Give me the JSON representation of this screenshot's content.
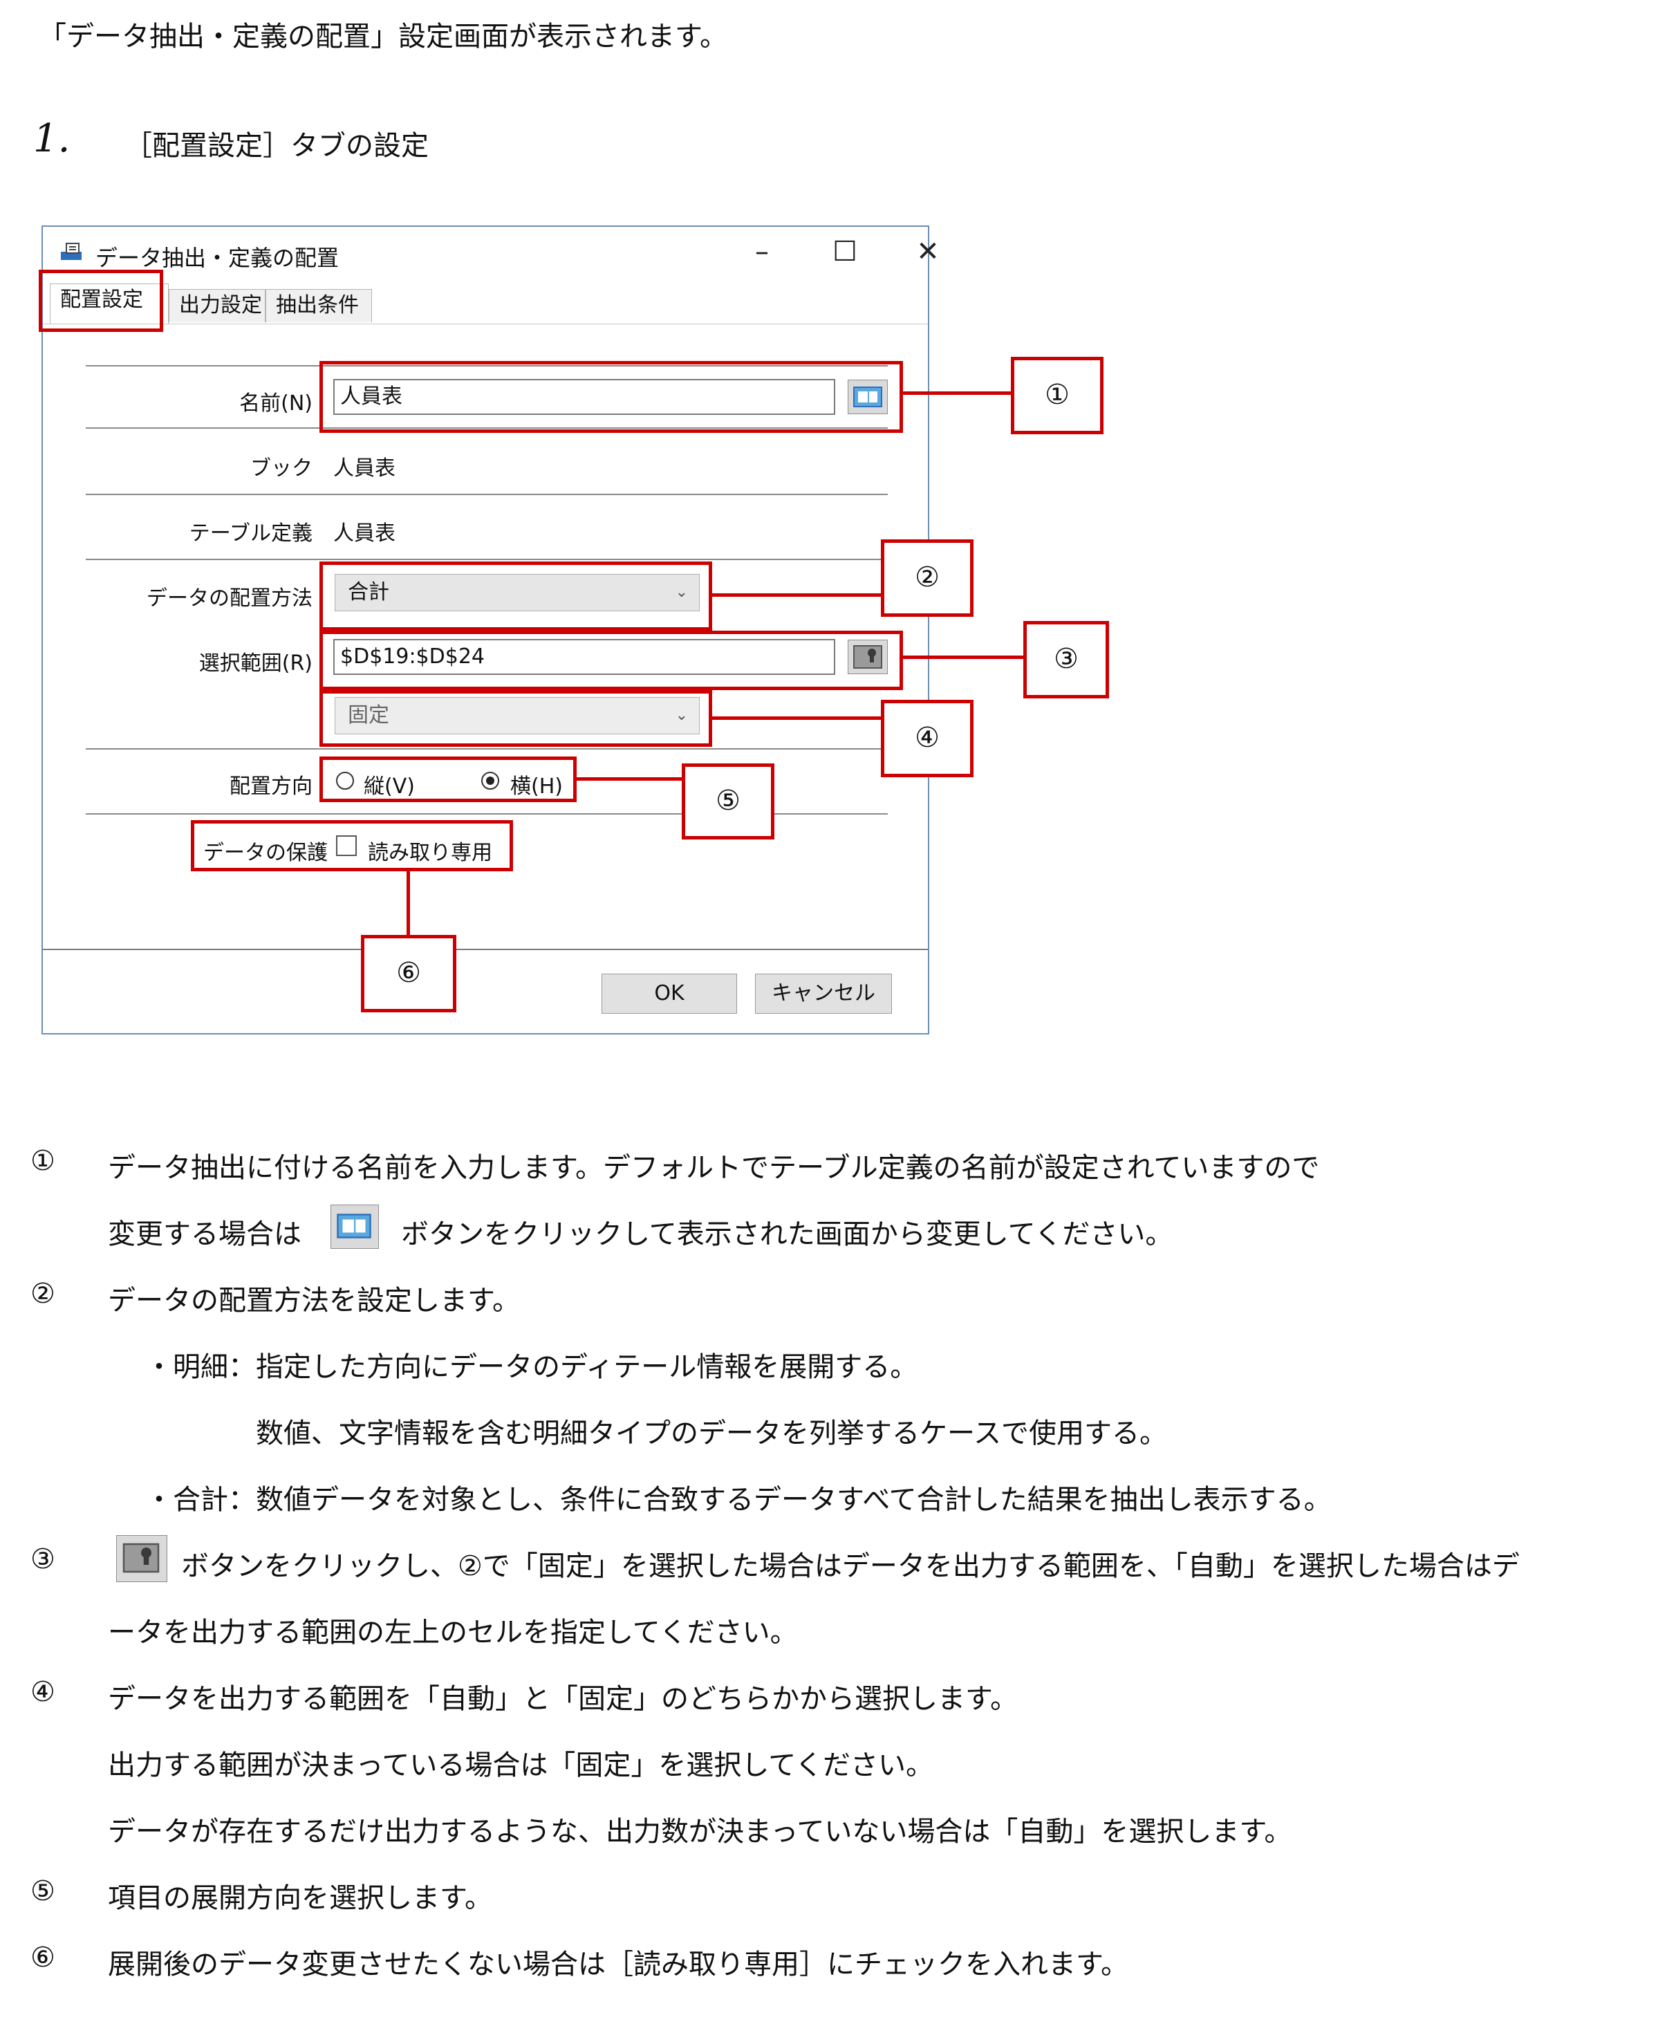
{
  "intro": "「データ抽出・定義の配置」設定画面が表示されます。",
  "step": {
    "number": "1.",
    "title": "［配置設定］タブの設定"
  },
  "dialog": {
    "title": "データ抽出・定義の配置",
    "window_buttons": {
      "minimize": "–",
      "maximize": "☐",
      "close": "✕"
    },
    "tabs": [
      "配置設定",
      "出力設定",
      "抽出条件"
    ],
    "fields": {
      "name_label": "名前(N)",
      "name_value": "人員表",
      "book_label": "ブック",
      "book_value": "人員表",
      "table_label": "テーブル定義",
      "table_value": "人員表",
      "method_label": "データの配置方法",
      "method_value": "合計",
      "range_label": "選択範囲(R)",
      "range_value": "$D$19:$D$24",
      "fixed_value": "固定",
      "direction_label": "配置方向",
      "vertical_label": "縦(V)",
      "horizontal_label": "横(H)",
      "direction_selected": "horizontal",
      "protect_label": "データの保護",
      "readonly_label": "読み取り専用",
      "readonly_checked": false
    },
    "buttons": {
      "ok": "OK",
      "cancel": "キャンセル"
    }
  },
  "callouts": [
    "①",
    "②",
    "③",
    "④",
    "⑤",
    "⑥"
  ],
  "descriptions": [
    {
      "num": "①",
      "lines": [
        "データ抽出に付ける名前を入力します。デフォルトでテーブル定義の名前が設定されていますので",
        "変更する場合は",
        "ボタンをクリックして表示された画面から変更してください。"
      ]
    },
    {
      "num": "②",
      "lines": [
        "データの配置方法を設定します。",
        "・明細：指定した方向にデータのディテール情報を展開する。",
        "数値、文字情報を含む明細タイプのデータを列挙するケースで使用する。",
        "・合計：数値データを対象とし、条件に合致するデータすべて合計した結果を抽出し表示する。"
      ]
    },
    {
      "num": "③",
      "lines": [
        "ボタンをクリックし、②で「固定」を選択した場合はデータを出力する範囲を、「自動」を選択した場合はデ",
        "ータを出力する範囲の左上のセルを指定してください。"
      ]
    },
    {
      "num": "④",
      "lines": [
        "データを出力する範囲を「自動」と「固定」のどちらかから選択します。",
        "出力する範囲が決まっている場合は「固定」を選択してください。",
        "データが存在するだけ出力するような、出力数が決まっていない場合は「自動」を選択します。"
      ]
    },
    {
      "num": "⑤",
      "lines": [
        "項目の展開方向を選択します。"
      ]
    },
    {
      "num": "⑥",
      "lines": [
        "展開後のデータ変更させたくない場合は［読み取り専用］にチェックを入れます。"
      ]
    }
  ],
  "colors": {
    "annotation": "#cc0000",
    "dialog_border": "#6b8fb5",
    "selected_tab": "#ffffff"
  }
}
